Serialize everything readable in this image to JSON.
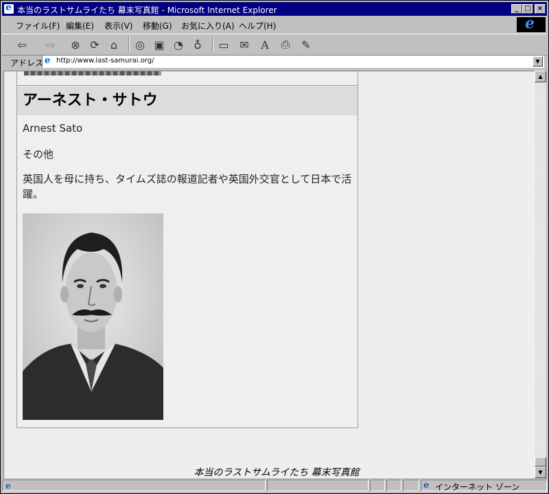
{
  "window": {
    "title": "本当のラストサムライたち 幕末写真館 - Microsoft Internet Explorer",
    "min_label": "_",
    "max_label": "□",
    "close_label": "×"
  },
  "menu": {
    "items": [
      "ファイル(F)",
      "編集(E)",
      "表示(V)",
      "移動(G)",
      "お気に入り(A)",
      "ヘルプ(H)"
    ]
  },
  "toolbar": {
    "icons": [
      "back-icon",
      "forward-icon",
      "stop-icon",
      "refresh-icon",
      "home-icon",
      "search-icon",
      "favorites-icon",
      "history-icon",
      "channels-icon",
      "fullscreen-icon",
      "mail-icon",
      "font-icon",
      "print-icon",
      "edit-icon"
    ]
  },
  "address": {
    "label": "アドレス",
    "url": "http://www.last-samurai.org/"
  },
  "content": {
    "title": "アーネスト・サトウ",
    "name_en": "Arnest Sato",
    "category": "その他",
    "description": "英国人を母に持ち、タイムズ誌の報道記者や英国外交官として日本で活躍。",
    "footer": "本当のラストサムライたち 幕末写真館"
  },
  "status": {
    "zone": "インターネット ゾーン"
  },
  "colors": {
    "titlebar": "#000080",
    "chrome": "#c0c0c0",
    "content_bg": "#eeeeee",
    "heading_bg": "#dcdcdc"
  }
}
